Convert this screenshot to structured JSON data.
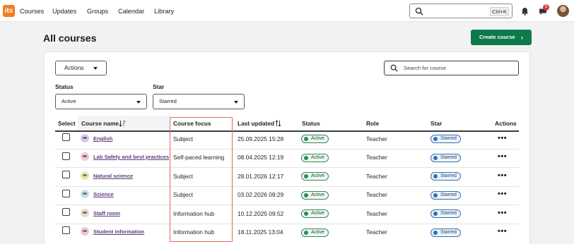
{
  "app": {
    "logo_text": "its"
  },
  "nav": {
    "items": [
      {
        "label": "Courses"
      },
      {
        "label": "Updates"
      },
      {
        "label": "Groups"
      },
      {
        "label": "Calendar"
      },
      {
        "label": "Library"
      }
    ]
  },
  "topsearch": {
    "shortcut": "Ctrl+K"
  },
  "notifications": {
    "count": "5"
  },
  "page": {
    "title": "All courses",
    "create_label": "Create course"
  },
  "toolbar": {
    "actions_label": "Actions",
    "search_placeholder": "Search for course"
  },
  "filters": {
    "status": {
      "label": "Status",
      "value": "Active"
    },
    "star": {
      "label": "Star",
      "value": "Starred"
    }
  },
  "table": {
    "headers": {
      "select": "Select",
      "name": "Course name",
      "focus": "Course focus",
      "updated": "Last updated",
      "status": "Status",
      "role": "Role",
      "star": "Star",
      "actions": "Actions"
    },
    "rows": [
      {
        "name": "English",
        "focus": "Subject",
        "updated": "25.09.2025 15:28",
        "status": "Active",
        "role": "Teacher",
        "star": "Starred",
        "icon_color": "#d9c6ef",
        "icon": "course-cap-icon"
      },
      {
        "name": "Lab Safety and best practices",
        "focus": "Self-paced learning",
        "updated": "08.04.2025 12:19",
        "status": "Active",
        "role": "Teacher",
        "star": "Starred",
        "icon_color": "#f3c6d8",
        "icon": "course-cap-icon"
      },
      {
        "name": "Natural science",
        "focus": "Subject",
        "updated": "28.01.2026 12:17",
        "status": "Active",
        "role": "Teacher",
        "star": "Starred",
        "icon_color": "#e3ecad",
        "icon": "course-cap-icon"
      },
      {
        "name": "Science",
        "focus": "Subject",
        "updated": "03.02.2026 09:29",
        "status": "Active",
        "role": "Teacher",
        "star": "Starred",
        "icon_color": "#bfe3ef",
        "icon": "course-cap-icon"
      },
      {
        "name": "Staff room",
        "focus": "Information hub",
        "updated": "10.12.2025 09:52",
        "status": "Active",
        "role": "Teacher",
        "star": "Starred",
        "icon_color": "#e6d9cc",
        "icon": "course-cap-icon"
      },
      {
        "name": "Student information",
        "focus": "Information hub",
        "updated": "18.11.2025 13:04",
        "status": "Active",
        "role": "Teacher",
        "star": "Starred",
        "icon_color": "#f3c6d8",
        "icon": "course-cap-icon"
      }
    ],
    "row_action_glyph": "•••"
  },
  "colors": {
    "brand": "#f47b20",
    "primary": "#0d7a4c",
    "highlight_border": "#e06a5a"
  }
}
